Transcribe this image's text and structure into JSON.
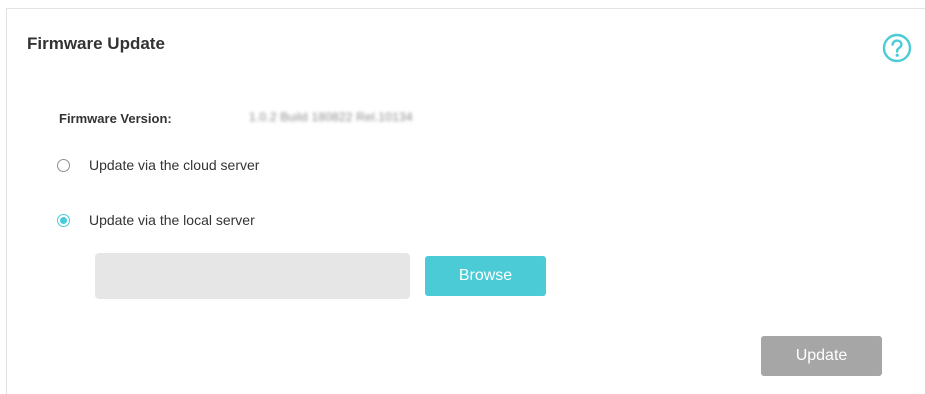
{
  "panel": {
    "title": "Firmware Update",
    "help_icon": "question-circle-icon"
  },
  "firmware": {
    "label": "Firmware Version:",
    "value": "1.0.2 Build 180822 Rel.10134",
    "value_blurred": true
  },
  "options": {
    "cloud_label": "Update via the cloud server",
    "cloud_selected": false,
    "local_label": "Update via the local server",
    "local_selected": true
  },
  "file_input": {
    "value": "",
    "placeholder": ""
  },
  "buttons": {
    "browse_label": "Browse",
    "update_label": "Update"
  },
  "colors": {
    "accent": "#4acbd6",
    "disabled_button": "#a6a6a6",
    "text": "#333333",
    "field_bg": "#e6e6e6"
  }
}
